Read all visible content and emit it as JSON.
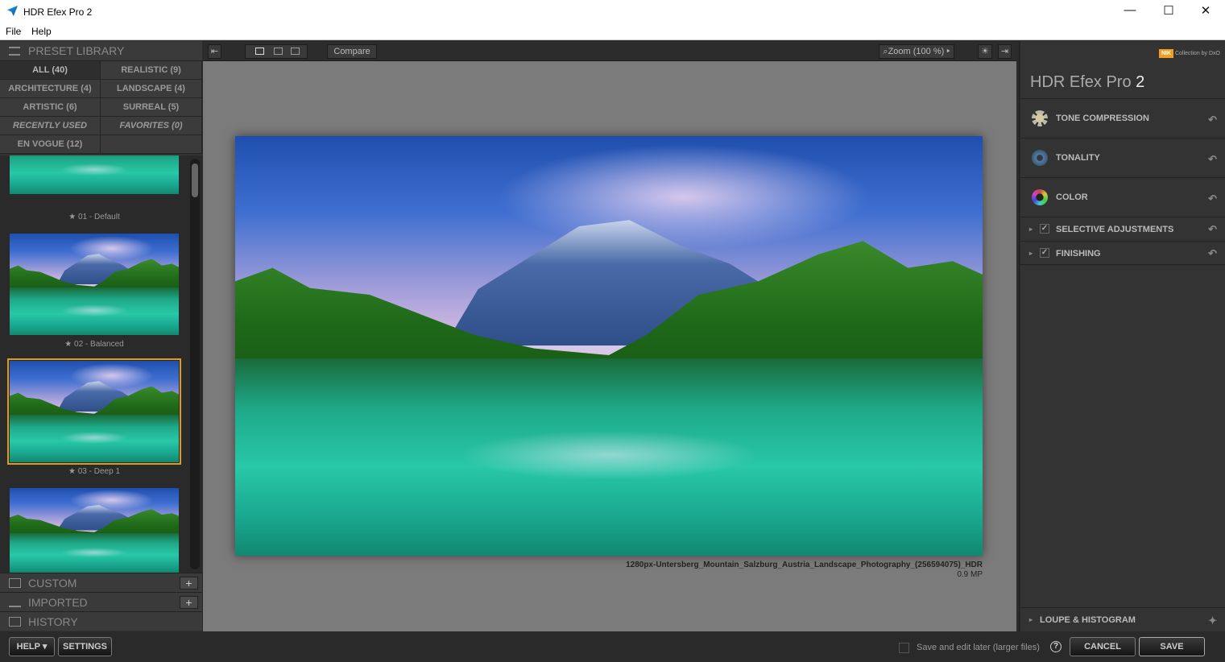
{
  "window": {
    "title": "HDR Efex Pro 2",
    "minimize": "—",
    "maximize": "☐",
    "close": "✕"
  },
  "menu": [
    "File",
    "Help"
  ],
  "preset_library": {
    "title": "PRESET LIBRARY",
    "categories": [
      {
        "label": "ALL (40)",
        "selected": true
      },
      {
        "label": "REALISTIC (9)"
      },
      {
        "label": "ARCHITECTURE (4)"
      },
      {
        "label": "LANDSCAPE (4)"
      },
      {
        "label": "ARTISTIC (6)"
      },
      {
        "label": "SURREAL (5)"
      },
      {
        "label": "RECENTLY USED"
      },
      {
        "label": "FAVORITES (0)"
      },
      {
        "label": "EN VOGUE (12)"
      },
      {
        "label": ""
      }
    ],
    "presets": [
      "★ 01 - Default",
      "★ 02 - Balanced",
      "★ 03 - Deep 1"
    ],
    "selected_preset": "★ 03 - Deep 1",
    "sections": [
      {
        "label": "CUSTOM",
        "icon": "custom-presets-icon"
      },
      {
        "label": "IMPORTED",
        "icon": "import-icon"
      },
      {
        "label": "HISTORY",
        "icon": "history-icon"
      }
    ],
    "add": "+"
  },
  "toolbar": {
    "compare": "Compare",
    "zoom": "Zoom (100 %)"
  },
  "image": {
    "filename": "1280px-Untersberg_Mountain_Salzburg_Austria_Landscape_Photography_(256594075)_HDR",
    "size": "0.9 MP"
  },
  "right_panel": {
    "brand": "Collection by DxO",
    "brand_mark": "NIK",
    "title": "HDR Efex Pro",
    "title_version": "2",
    "filters": [
      {
        "label": "TONE COMPRESSION"
      },
      {
        "label": "TONALITY"
      },
      {
        "label": "COLOR"
      }
    ],
    "sections": [
      {
        "label": "SELECTIVE ADJUSTMENTS",
        "checked": true
      },
      {
        "label": "FINISHING",
        "checked": true
      }
    ],
    "loupe": "LOUPE & HISTOGRAM",
    "undo": "↶",
    "check": "✓",
    "expand": "▸"
  },
  "bottom": {
    "help": "HELP ▾",
    "settings": "SETTINGS",
    "save_later": "Save and edit later (larger files)",
    "help_icon": "?",
    "cancel": "CANCEL",
    "save": "SAVE"
  },
  "colors": {
    "accent_selected": "#e09a1a",
    "panel": "#333333",
    "canvas": "#7b7b7b"
  }
}
